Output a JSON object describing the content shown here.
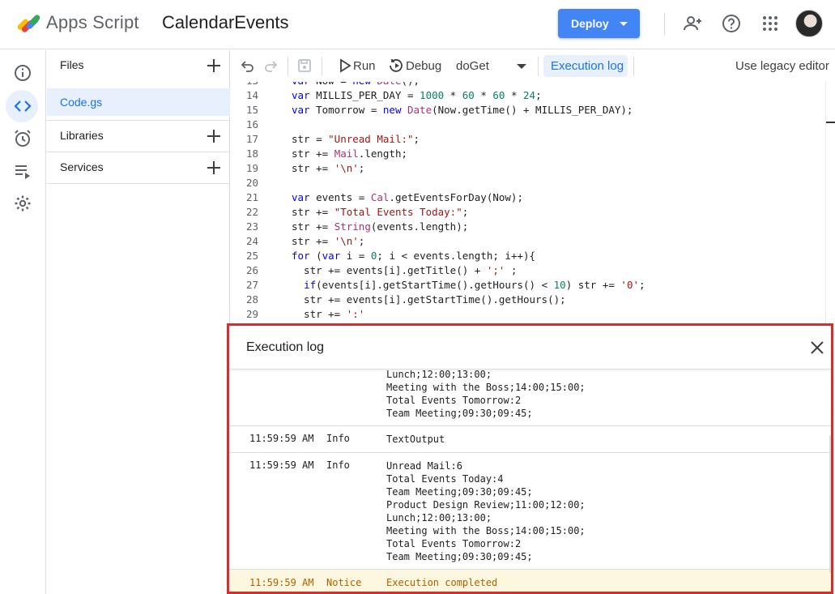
{
  "header": {
    "app_name": "Apps Script",
    "project_name": "CalendarEvents",
    "deploy_label": "Deploy"
  },
  "sidebar": {
    "files_label": "Files",
    "file_items": [
      "Code.gs"
    ],
    "libraries_label": "Libraries",
    "services_label": "Services"
  },
  "toolbar": {
    "run_label": "Run",
    "debug_label": "Debug",
    "function_select": "doGet",
    "execution_log_label": "Execution log",
    "legacy_label": "Use legacy editor"
  },
  "editor": {
    "lines": [
      {
        "n": "13",
        "code": "var Now = new Date();"
      },
      {
        "n": "14",
        "code": "var MILLIS_PER_DAY = 1000 * 60 * 60 * 24;"
      },
      {
        "n": "15",
        "code": "var Tomorrow = new Date(Now.getTime() + MILLIS_PER_DAY);"
      },
      {
        "n": "16",
        "code": ""
      },
      {
        "n": "17",
        "code": "str = \"Unread Mail:\";"
      },
      {
        "n": "18",
        "code": "str += Mail.length;"
      },
      {
        "n": "19",
        "code": "str += '\\n';"
      },
      {
        "n": "20",
        "code": ""
      },
      {
        "n": "21",
        "code": "var events = Cal.getEventsForDay(Now);"
      },
      {
        "n": "22",
        "code": "str += \"Total Events Today:\";"
      },
      {
        "n": "23",
        "code": "str += String(events.length);"
      },
      {
        "n": "24",
        "code": "str += '\\n';"
      },
      {
        "n": "25",
        "code": "for (var i = 0; i < events.length; i++){"
      },
      {
        "n": "26",
        "code": "  str += events[i].getTitle() + ';' ;"
      },
      {
        "n": "27",
        "code": "  if(events[i].getStartTime().getHours() < 10) str += '0';"
      },
      {
        "n": "28",
        "code": "  str += events[i].getStartTime().getHours();"
      },
      {
        "n": "29",
        "code": "  str += ':'"
      }
    ]
  },
  "log": {
    "title": "Execution log",
    "entry0_lines": "Lunch;12:00;13:00;\nMeeting with the Boss;14:00;15:00;\nTotal Events Tomorrow:2\nTeam Meeting;09:30;09:45;",
    "entries": [
      {
        "time": "11:59:59 AM",
        "level": "Info",
        "message": "TextOutput"
      },
      {
        "time": "11:59:59 AM",
        "level": "Info",
        "message": "Unread Mail:6\nTotal Events Today:4\nTeam Meeting;09:30;09:45;\nProduct Design Review;11:00;12:00;\nLunch;12:00;13:00;\nMeeting with the Boss;14:00;15:00;\nTotal Events Tomorrow:2\nTeam Meeting;09:30;09:45;"
      },
      {
        "time": "11:59:59 AM",
        "level": "Notice",
        "message": "Execution completed"
      }
    ]
  }
}
